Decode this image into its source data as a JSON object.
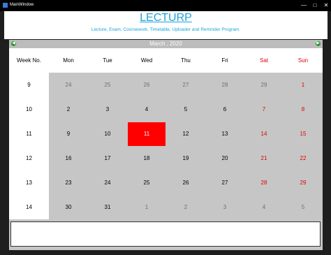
{
  "window": {
    "title": "MainWindow",
    "min_glyph": "—",
    "max_glyph": "□",
    "close_glyph": "✕"
  },
  "header": {
    "title": "LECTURP",
    "subtitle": "Lecture, Exam, Coursework, Timetable, Uploader and Reminder Program."
  },
  "nav": {
    "month": "March",
    "year": "2020",
    "month_label": "March ,  2020",
    "prev_glyph": "◀",
    "next_glyph": "▶"
  },
  "calendar": {
    "headers": [
      "Week No.",
      "Mon",
      "Tue",
      "Wed",
      "Thu",
      "Fri",
      "Sat",
      "Sun"
    ],
    "weeks": [
      {
        "week": "9",
        "days": [
          "24",
          "25",
          "26",
          "27",
          "28",
          "29",
          "1"
        ]
      },
      {
        "week": "10",
        "days": [
          "2",
          "3",
          "4",
          "5",
          "6",
          "7",
          "8"
        ]
      },
      {
        "week": "11",
        "days": [
          "9",
          "10",
          "11",
          "12",
          "13",
          "14",
          "15"
        ]
      },
      {
        "week": "12",
        "days": [
          "16",
          "17",
          "18",
          "19",
          "20",
          "21",
          "22"
        ]
      },
      {
        "week": "13",
        "days": [
          "23",
          "24",
          "25",
          "26",
          "27",
          "28",
          "29"
        ]
      },
      {
        "week": "14",
        "days": [
          "30",
          "31",
          "1",
          "2",
          "3",
          "4",
          "5"
        ]
      }
    ],
    "selected_day": "11"
  },
  "colors": {
    "accent": "#1aa3d9",
    "weekend": "#e00000",
    "today": "#ff0000",
    "grid_bg": "#c6c6c6"
  }
}
